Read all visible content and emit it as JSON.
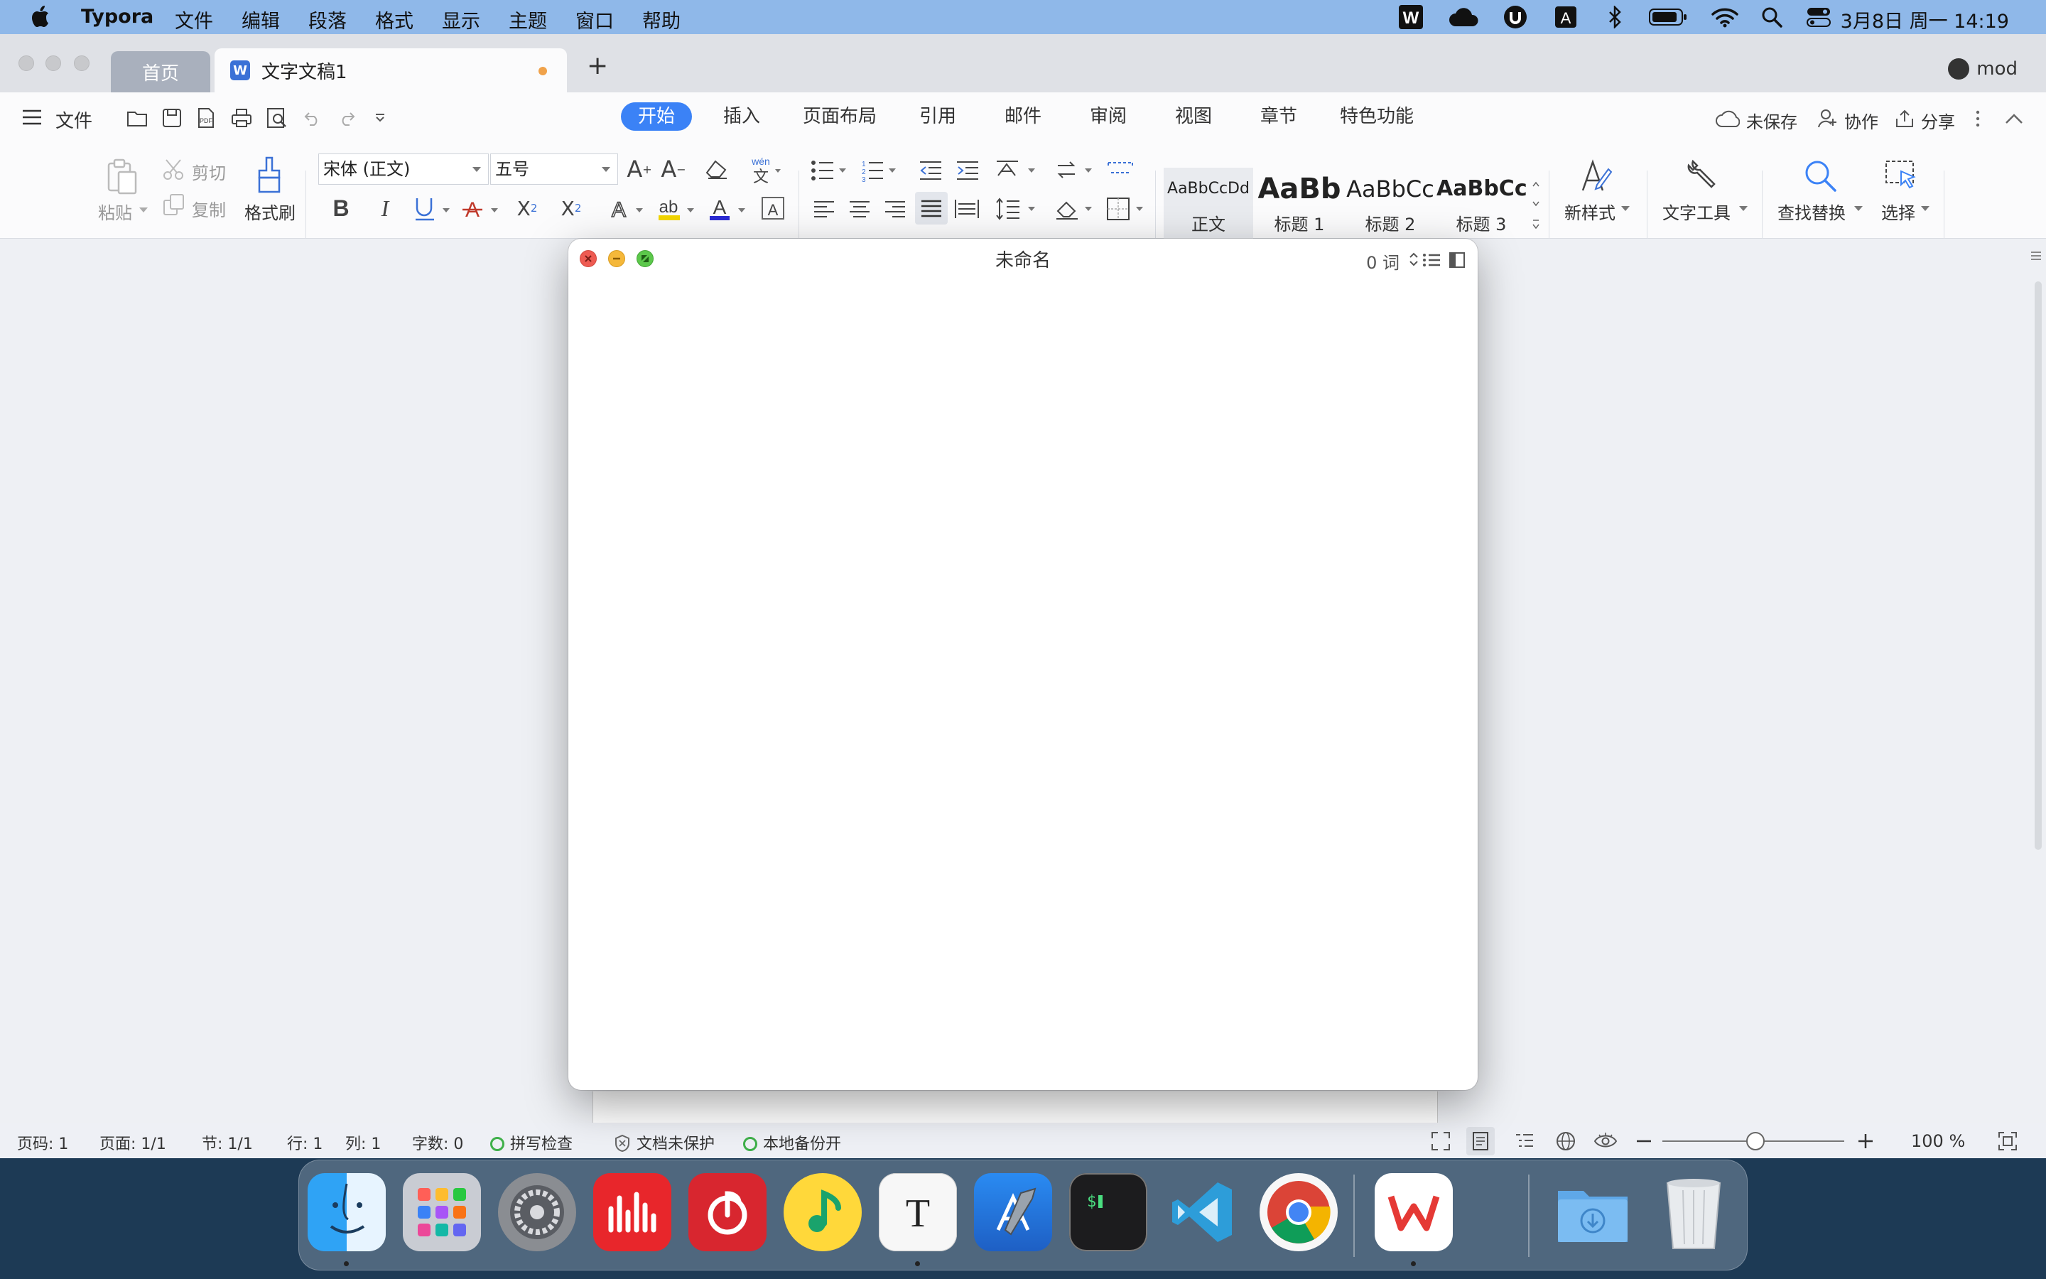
{
  "menubar": {
    "app_name": "Typora",
    "menus": [
      "文件",
      "编辑",
      "段落",
      "格式",
      "显示",
      "主题",
      "窗口",
      "帮助"
    ],
    "clock": "3月8日 周一  14:19",
    "tray_icons": [
      "wps-icon",
      "cloud-icon",
      "vpn-icon",
      "input-method-icon",
      "bluetooth-icon",
      "battery-icon",
      "wifi-icon",
      "spotlight-icon",
      "control-center-icon"
    ]
  },
  "wps": {
    "tabs": {
      "home": "首页",
      "doc": "文字文稿1",
      "new_tab": "+"
    },
    "user": "mod",
    "ribbon_left": {
      "menu": "文件"
    },
    "ribbon_tabs": [
      "开始",
      "插入",
      "页面布局",
      "引用",
      "邮件",
      "审阅",
      "视图",
      "章节",
      "特色功能"
    ],
    "ribbon_right": {
      "unsaved": "未保存",
      "collab": "协作",
      "share": "分享"
    },
    "clipboard": {
      "paste": "粘贴",
      "cut": "剪切",
      "copy": "复制",
      "format_painter": "格式刷"
    },
    "font": {
      "name": "宋体 (正文)",
      "size": "五号"
    },
    "styles": [
      {
        "sample": "AaBbCcDd",
        "name": "正文"
      },
      {
        "sample": "AaBb",
        "name": "标题 1"
      },
      {
        "sample": "AaBbCc",
        "name": "标题 2"
      },
      {
        "sample": "AaBbCc",
        "name": "标题 3"
      }
    ],
    "tools": {
      "new_style": "新样式",
      "text_tools": "文字工具",
      "find_replace": "查找替换",
      "select": "选择"
    },
    "status": {
      "page_no": "页码: 1",
      "pages": "页面: 1/1",
      "section": "节: 1/1",
      "row": "行: 1",
      "col": "列: 1",
      "words": "字数: 0",
      "spell": "拼写检查",
      "protect": "文档未保护",
      "backup": "本地备份开",
      "zoom": "100 %"
    }
  },
  "typora": {
    "title": "未命名",
    "word_count": "0 词"
  },
  "dock": {
    "apps": [
      "Finder",
      "Launchpad",
      "System Preferences",
      "Podcast",
      "NetEase Music",
      "QQ Music",
      "Typora",
      "Xcode",
      "Terminal",
      "VS Code",
      "Chrome",
      "WPS",
      "Downloads",
      "Trash"
    ]
  },
  "colors": {
    "accent": "#3b82f6",
    "menubar": "#8fb8e9",
    "close": "#ee5b52",
    "minimize": "#f5b83a",
    "zoom": "#5cc84b"
  }
}
